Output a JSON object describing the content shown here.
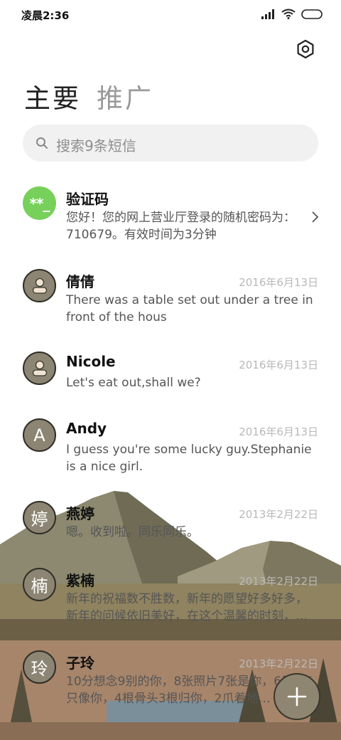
{
  "status_bar": {
    "time": "凌晨2:36"
  },
  "header": {
    "tabs": [
      {
        "label": "主要"
      },
      {
        "label": "推广"
      }
    ]
  },
  "search": {
    "placeholder": "搜索9条短信"
  },
  "conversations": [
    {
      "name": "验证码",
      "avatar_text": "**_",
      "date": "",
      "preview": "您好！您的网上营业厅登录的随机密码为：710679。有效时间为3分钟"
    },
    {
      "name": "倩倩",
      "avatar_text": "",
      "date": "2016年6月13日",
      "preview": "There was a table set out under a tree in front of the hous"
    },
    {
      "name": "Nicole",
      "avatar_text": "",
      "date": "2016年6月13日",
      "preview": "Let's eat out,shall we?"
    },
    {
      "name": "Andy",
      "avatar_text": "A",
      "date": "2016年6月13日",
      "preview": "I guess you're some lucky guy.Stephanie is a nice girl."
    },
    {
      "name": "燕婷",
      "avatar_text": "婷",
      "date": "2013年2月22日",
      "preview": "嗯。收到啦。同乐同乐。"
    },
    {
      "name": "紫楠",
      "avatar_text": "楠",
      "date": "2013年2月22日",
      "preview": "新年的祝福数不胜数，新年的愿望好多好多，新年的问候依旧美好，在这个温馨的时刻，…"
    },
    {
      "name": "子玲",
      "avatar_text": "玲",
      "date": "2013年2月22日",
      "preview": "10分想念9别的你，8张照片7张是你，6只狗5只像你，4根骨头3根归你，2爪着地…"
    }
  ],
  "icons": {
    "signal": "signal-icon",
    "wifi": "wifi-icon",
    "battery": "battery-icon",
    "settings": "settings-icon",
    "search": "search-icon",
    "chevron": "chevron-right-icon",
    "person": "person-icon",
    "compose": "plus-icon"
  },
  "colors": {
    "verification_avatar": "#76d05a",
    "contact_avatar": "#8c8573",
    "fab": "#8e8671"
  }
}
